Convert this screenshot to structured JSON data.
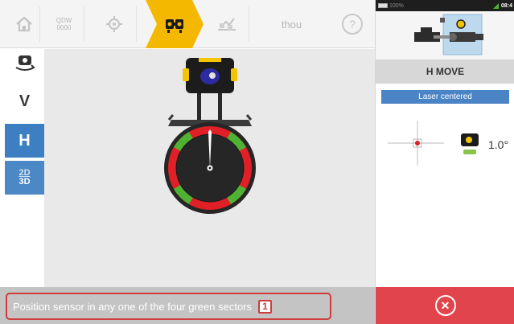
{
  "toolbar": {
    "items": [
      {
        "name": "home-icon"
      },
      {
        "name": "machine-info-icon",
        "text_line1": "QDW",
        "text_line2": "0000"
      },
      {
        "name": "dimensions-icon"
      },
      {
        "name": "measure-icon",
        "active": true
      },
      {
        "name": "results-icon"
      },
      {
        "name": "units-toggle",
        "label": "thou"
      },
      {
        "name": "help-icon",
        "label": "?"
      }
    ]
  },
  "side": {
    "rotate_icon": "sensor-rotate-icon",
    "v_label": "V",
    "h_label": "H",
    "view_2d": "2D",
    "view_3d": "3D"
  },
  "instruction": {
    "text": "Position sensor in any one of the four green sectors",
    "badge": "1"
  },
  "panel": {
    "status": {
      "battery": "100%",
      "clock": "08:4"
    },
    "mode_title": "H MOVE",
    "laser_status": "Laser centered",
    "angle": "1.0°",
    "cancel_icon": "cancel-icon"
  },
  "colors": {
    "accent": "#f5b800",
    "blue": "#3c7fc3",
    "red": "#e2444b",
    "green": "#4fb233",
    "dial_red": "#e01f27"
  }
}
